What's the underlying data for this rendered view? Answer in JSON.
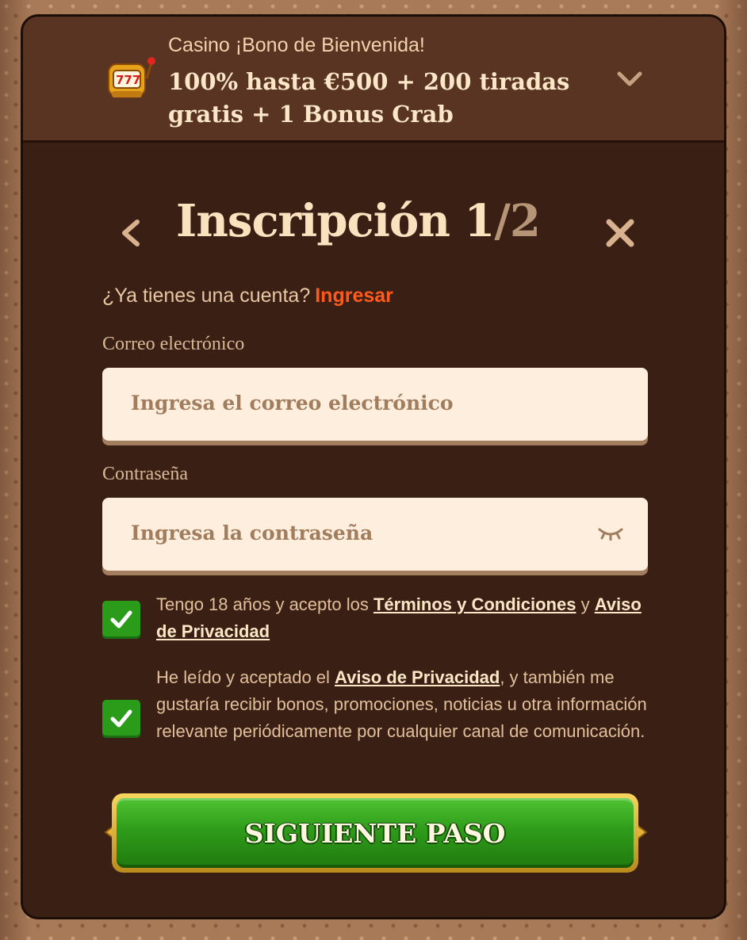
{
  "promo": {
    "subtitle": "Casino ¡Bono de Bienvenida!",
    "title": "100% hasta €500 + 200 tiradas gratis + 1 Bonus Crab",
    "icon": "slot-machine-icon"
  },
  "header": {
    "title": "Inscripción 1",
    "step_suffix": "/2"
  },
  "account": {
    "question": "¿Ya tienes una cuenta?",
    "login_label": "Ingresar"
  },
  "form": {
    "email_label": "Correo electrónico",
    "email_placeholder": "Ingresa el correo electrónico",
    "email_value": "",
    "password_label": "Contraseña",
    "password_placeholder": "Ingresa la contraseña",
    "password_value": ""
  },
  "consents": {
    "terms": {
      "checked": true,
      "text_before": "Tengo 18 años y acepto los ",
      "link_terms": "Términos y Condiciones",
      "text_middle": " y ",
      "link_privacy": "Aviso de Privacidad"
    },
    "marketing": {
      "checked": true,
      "text_before": "He leído y aceptado el ",
      "link_privacy": "Aviso de Privacidad",
      "text_after": ", y también me gustaría recibir bonos, promociones, noticias u otra información relevante periódicamente por cualquier canal de comunicación."
    }
  },
  "cta": {
    "label": "SIGUIENTE PASO"
  },
  "colors": {
    "modal_bg": "#3a2014",
    "promo_bg": "#5a3422",
    "accent_link": "#ff5a1e",
    "checkbox": "#2a9c1a",
    "button_green": "#2f9c1a",
    "button_gold": "#f8d55c"
  }
}
